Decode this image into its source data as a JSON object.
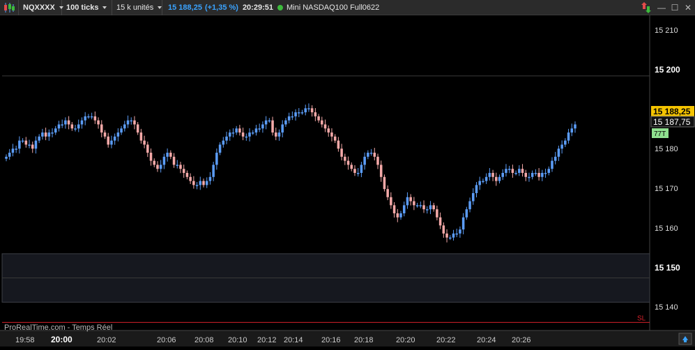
{
  "toolbar": {
    "symbol": "NQXXXX",
    "interval": "100 ticks",
    "units": "15 k unités",
    "price": "15 188,25",
    "change": "(+1,35 %)",
    "time": "20:29:51",
    "instrument": "Mini NASDAQ100 Full0622",
    "icons": [
      "candles-icon",
      "trade-arrows-icon",
      "minimize-icon",
      "maximize-icon",
      "close-icon"
    ]
  },
  "chart": {
    "watermark": "ProRealTime.com - Temps Réel",
    "price_labels": [
      "15 210",
      "15 200",
      "15 180",
      "15 170",
      "15 160",
      "15 150",
      "15 140"
    ],
    "current_price": "15 188,25",
    "secondary_price": "15 187,75",
    "tick_badge": "77T",
    "sl_label": "SL",
    "time_labels": [
      "19:58",
      "20:00",
      "20:02",
      "20:06",
      "20:08",
      "20:10",
      "20:12",
      "20:14",
      "20:16",
      "20:18",
      "20:20",
      "20:22",
      "20:24",
      "20:26"
    ],
    "colors": {
      "bull": "#5b9cf6",
      "bear": "#f4a9a8",
      "highlight": "#f5c400",
      "sl_line": "#d4202a",
      "badge": "#8fe08f"
    }
  },
  "chart_data": {
    "type": "candlestick",
    "ylim": [
      15137,
      15215
    ],
    "stop_loss": 15139,
    "zones": [
      [
        15144,
        15156
      ]
    ],
    "closes": [
      15180,
      15181,
      15182,
      15182,
      15184,
      15184,
      15183,
      15183,
      15182,
      15184,
      15185,
      15186,
      15185,
      15186,
      15186,
      15187,
      15188,
      15188,
      15189,
      15188,
      15187,
      15187,
      15188,
      15189,
      15190,
      15190,
      15190,
      15189,
      15188,
      15186,
      15185,
      15183,
      15184,
      15185,
      15186,
      15187,
      15188,
      15189,
      15189,
      15188,
      15186,
      15184,
      15183,
      15181,
      15179,
      15178,
      15177,
      15178,
      15180,
      15181,
      15180,
      15178,
      15178,
      15177,
      15176,
      15175,
      15174,
      15173,
      15173,
      15174,
      15173,
      15174,
      15175,
      15178,
      15181,
      15183,
      15184,
      15185,
      15186,
      15186,
      15187,
      15186,
      15185,
      15185,
      15186,
      15186,
      15187,
      15187,
      15188,
      15189,
      15189,
      15186,
      15185,
      15186,
      15188,
      15189,
      15190,
      15190,
      15191,
      15191,
      15191,
      15192,
      15192,
      15191,
      15190,
      15189,
      15188,
      15187,
      15186,
      15185,
      15184,
      15182,
      15180,
      15179,
      15178,
      15177,
      15176,
      15176,
      15178,
      15180,
      15181,
      15181,
      15180,
      15178,
      15175,
      15172,
      15170,
      15168,
      15166,
      15165,
      15166,
      15168,
      15170,
      15169,
      15168,
      15168,
      15168,
      15167,
      15167,
      15168,
      15167,
      15165,
      15163,
      15161,
      15160,
      15160,
      15161,
      15161,
      15162,
      15165,
      15167,
      15169,
      15171,
      15173,
      15174,
      15174,
      15175,
      15176,
      15175,
      15174,
      15175,
      15176,
      15177,
      15177,
      15176,
      15176,
      15177,
      15176,
      15175,
      15175,
      15176,
      15176,
      15175,
      15176,
      15176,
      15177,
      15179,
      15180,
      15182,
      15183,
      15184,
      15186,
      15187,
      15188
    ]
  }
}
